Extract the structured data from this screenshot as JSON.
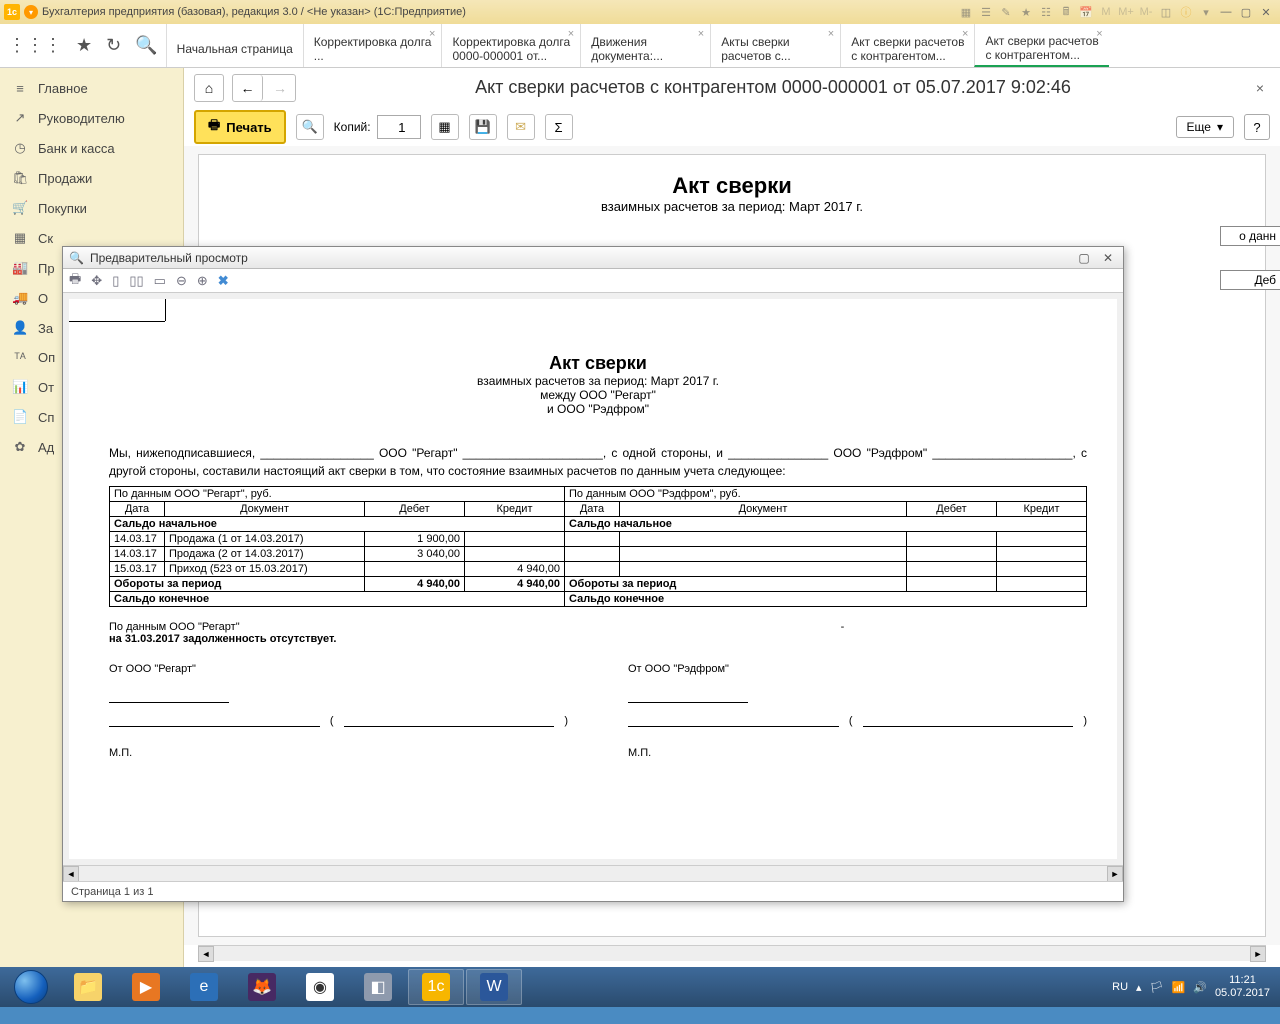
{
  "titlebar": {
    "text": "Бухгалтерия предприятия (базовая), редакция 3.0 / <Не указан>  (1С:Предприятие)"
  },
  "tabs": [
    {
      "l1": "Начальная страница"
    },
    {
      "l1": "Корректировка долга",
      "l2": "..."
    },
    {
      "l1": "Корректировка долга",
      "l2": "0000-000001 от..."
    },
    {
      "l1": "Движения",
      "l2": "документа:..."
    },
    {
      "l1": "Акты сверки",
      "l2": "расчетов с..."
    },
    {
      "l1": "Акт сверки расчетов",
      "l2": "с контрагентом..."
    },
    {
      "l1": "Акт сверки расчетов",
      "l2": "с контрагентом...",
      "active": true
    }
  ],
  "sidebar": [
    {
      "ic": "≡",
      "t": "Главное"
    },
    {
      "ic": "↗",
      "t": "Руководителю"
    },
    {
      "ic": "◷",
      "t": "Банк и касса"
    },
    {
      "ic": "🛍",
      "t": "Продажи"
    },
    {
      "ic": "🛒",
      "t": "Покупки"
    },
    {
      "ic": "▦",
      "t": "Ск"
    },
    {
      "ic": "🏭",
      "t": "Пр"
    },
    {
      "ic": "🚚",
      "t": "О"
    },
    {
      "ic": "👤",
      "t": "За"
    },
    {
      "ic": "ᵀᴬ",
      "t": "Оп"
    },
    {
      "ic": "📊",
      "t": "От"
    },
    {
      "ic": "📄",
      "t": "Сп"
    },
    {
      "ic": "✿",
      "t": "Ад"
    }
  ],
  "page": {
    "title": "Акт сверки расчетов с контрагентом 0000-000001 от 05.07.2017 9:02:46"
  },
  "toolbar": {
    "print": "Печать",
    "copies_lbl": "Копий:",
    "copies_val": "1",
    "more": "Еще"
  },
  "bg": {
    "h": "Акт сверки",
    "sub": "взаимных расчетов за период: Март 2017 г.",
    "peek1": "о данн",
    "peek2": "Деб"
  },
  "preview": {
    "title": "Предварительный просмотр",
    "status": "Страница 1 из 1",
    "doc": {
      "h": "Акт сверки",
      "sub1": "взаимных расчетов за период: Март 2017 г.",
      "sub2": "между ООО \"Регарт\"",
      "sub3": "и ООО \"Рэдфром\"",
      "intro": "Мы,   нижеподписавшиеся,   _________________   ООО   \"Регарт\"   _____________________,   с   одной   стороны,   и   _______________   ООО   \"Рэдфром\" _____________________, с другой стороны, составили настоящий акт сверки в том, что состояние взаимных расчетов по данным учета следующее:",
      "h_left": "По данным ООО \"Регарт\", руб.",
      "h_right": "По данным ООО \"Рэдфром\", руб.",
      "cols": {
        "d": "Дата",
        "doc": "Документ",
        "deb": "Дебет",
        "cr": "Кредит"
      },
      "rows": [
        {
          "b": true,
          "doc": "Сальдо начальное"
        },
        {
          "d": "14.03.17",
          "doc": "Продажа (1 от 14.03.2017)",
          "deb": "1 900,00"
        },
        {
          "d": "14.03.17",
          "doc": "Продажа (2 от 14.03.2017)",
          "deb": "3 040,00"
        },
        {
          "d": "15.03.17",
          "doc": "Приход (523 от 15.03.2017)",
          "cr": "4 940,00"
        },
        {
          "b": true,
          "doc": "Обороты за период",
          "deb": "4 940,00",
          "cr": "4 940,00",
          "r": "Обороты за период"
        },
        {
          "b": true,
          "doc": "Сальдо конечное",
          "r": "Сальдо конечное"
        }
      ],
      "row_r0": "Сальдо начальное",
      "after1": "По данным ООО \"Регарт\"",
      "after2": "на 31.03.2017 задолженность отсутствует.",
      "dash": "-",
      "from1": "От ООО \"Регарт\"",
      "from2": "От ООО \"Рэдфром\"",
      "mp": "М.П."
    }
  },
  "tray": {
    "lang": "RU",
    "time": "11:21",
    "date": "05.07.2017"
  }
}
